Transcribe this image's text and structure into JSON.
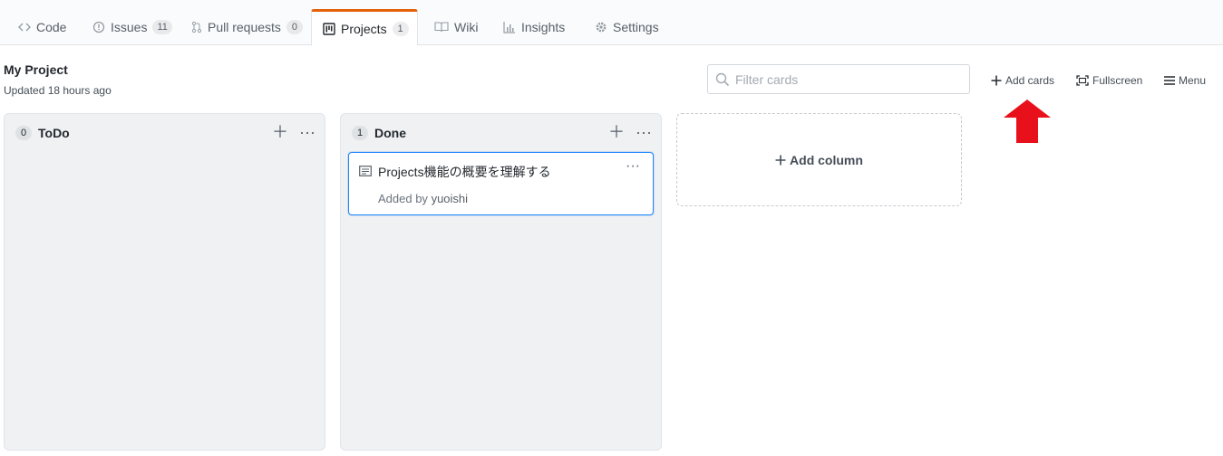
{
  "tabs": [
    {
      "label": "Code",
      "count": null,
      "icon": "code-icon"
    },
    {
      "label": "Issues",
      "count": "11",
      "icon": "issue-icon"
    },
    {
      "label": "Pull requests",
      "count": "0",
      "icon": "pull-request-icon"
    },
    {
      "label": "Projects",
      "count": "1",
      "icon": "project-icon"
    },
    {
      "label": "Wiki",
      "count": null,
      "icon": "book-icon"
    },
    {
      "label": "Insights",
      "count": null,
      "icon": "graph-icon"
    },
    {
      "label": "Settings",
      "count": null,
      "icon": "gear-icon"
    }
  ],
  "project": {
    "title": "My Project",
    "updated": "Updated 18 hours ago"
  },
  "filter": {
    "placeholder": "Filter cards"
  },
  "header_buttons": {
    "add_cards": "Add cards",
    "fullscreen": "Fullscreen",
    "menu": "Menu"
  },
  "columns": [
    {
      "name": "ToDo",
      "count": "0"
    },
    {
      "name": "Done",
      "count": "1",
      "cards": [
        {
          "title": "Projects機能の概要を理解する",
          "added_by_prefix": "Added by",
          "user": "yuoishi"
        }
      ]
    }
  ],
  "add_column_label": "Add column",
  "colors": {
    "accent_tab": "#e36209",
    "card_border": "#2188ff",
    "annotation_arrow": "#e8101a"
  }
}
